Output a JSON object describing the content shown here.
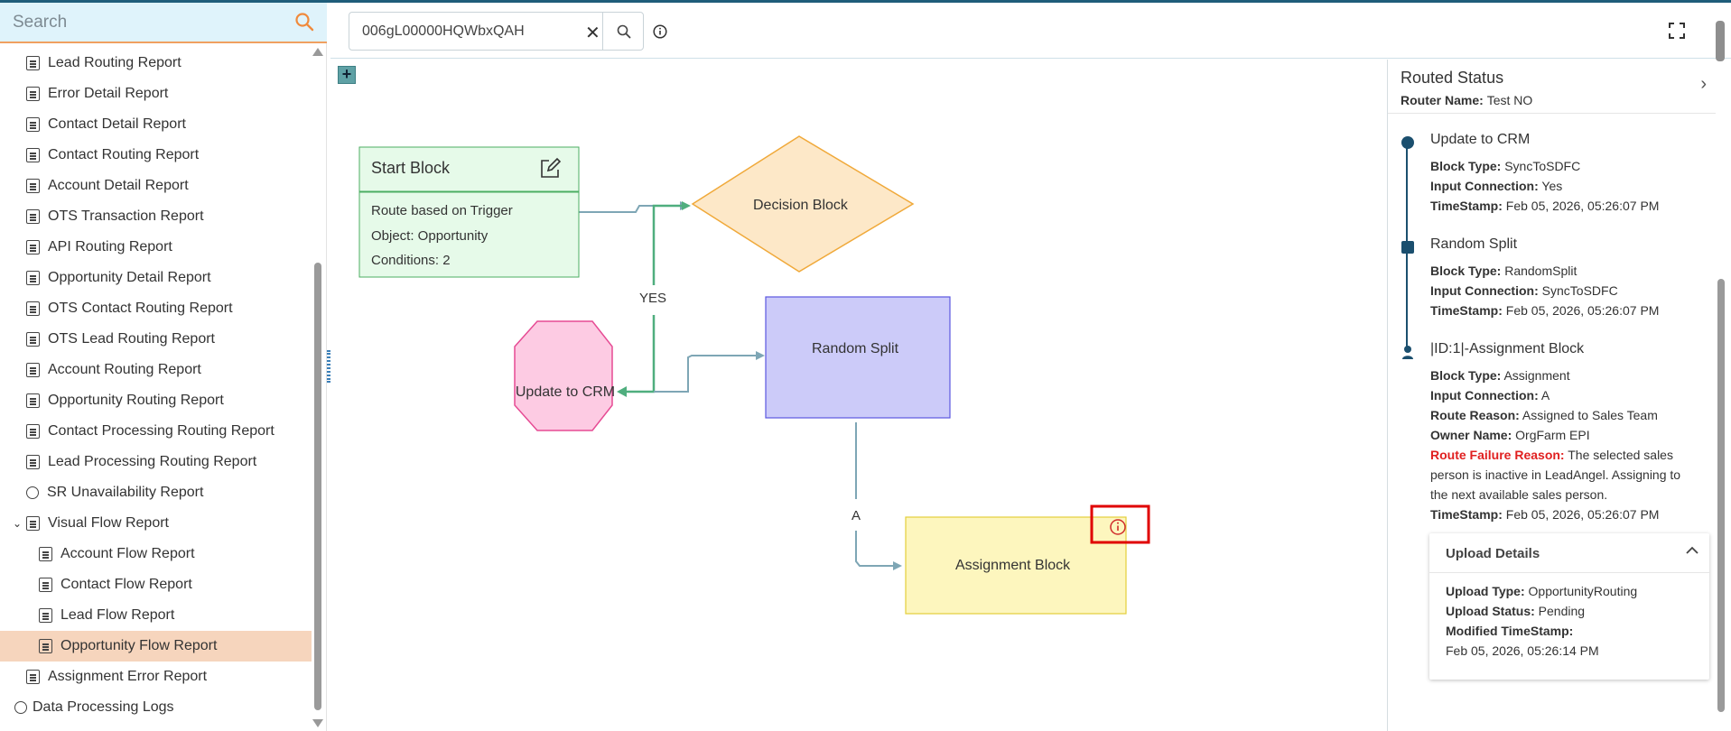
{
  "sidebar": {
    "search_placeholder": "Search",
    "items": [
      {
        "label": "Lead Routing Report",
        "level": 1
      },
      {
        "label": "Error Detail Report",
        "level": 1
      },
      {
        "label": "Contact Detail Report",
        "level": 1
      },
      {
        "label": "Contact Routing Report",
        "level": 1
      },
      {
        "label": "Account Detail Report",
        "level": 1
      },
      {
        "label": "OTS Transaction Report",
        "level": 1
      },
      {
        "label": "API Routing Report",
        "level": 1
      },
      {
        "label": "Opportunity Detail Report",
        "level": 1
      },
      {
        "label": "OTS Contact Routing Report",
        "level": 1
      },
      {
        "label": "OTS Lead Routing Report",
        "level": 1
      },
      {
        "label": "Account Routing Report",
        "level": 1
      },
      {
        "label": "Opportunity Routing Report",
        "level": 1
      },
      {
        "label": "Contact Processing Routing Report",
        "level": 1
      },
      {
        "label": "Lead Processing Routing Report",
        "level": 1
      },
      {
        "label": "SR Unavailability Report",
        "level": 1
      },
      {
        "label": "Visual Flow Report",
        "level": 1
      },
      {
        "label": "Account Flow Report",
        "level": 2
      },
      {
        "label": "Contact Flow Report",
        "level": 2
      },
      {
        "label": "Lead Flow Report",
        "level": 2
      },
      {
        "label": "Opportunity Flow Report",
        "level": 2
      },
      {
        "label": "Assignment Error Report",
        "level": 1
      },
      {
        "label": "Data Processing Logs",
        "level": 0
      }
    ]
  },
  "toolbar": {
    "query_value": "006gL00000HQWbxQAH"
  },
  "diagram": {
    "start_block": {
      "title": "Start Block",
      "line1": "Route based on Trigger",
      "line2": "Object: Opportunity",
      "line3": "Conditions: 2"
    },
    "decision_block": "Decision Block",
    "yes_label": "YES",
    "update_crm": "Update to CRM",
    "random_split": "Random Split",
    "a_label": "A",
    "assignment_block": "Assignment Block",
    "colors": {
      "start_fill": "#e6fae9",
      "start_border": "#4cae62",
      "decision_fill": "#fde8c8",
      "decision_border": "#f0a93a",
      "crm_fill": "#fdcbe3",
      "crm_border": "#e64b94",
      "split_fill": "#cccbf9",
      "split_border": "#5b57e0",
      "assign_fill": "#fdf6be",
      "assign_border": "#e3cf3b",
      "connector": "#7ea6b5",
      "yes_connector": "#4fae7e",
      "highlight": "#e00000"
    }
  },
  "panel": {
    "title": "Routed Status",
    "router_label": "Router Name:",
    "router_value": "Test NO",
    "entries": [
      {
        "title": "Update to CRM",
        "block_type_label": "Block Type:",
        "block_type": "SyncToSDFC",
        "input_label": "Input Connection:",
        "input": "Yes",
        "ts_label": "TimeStamp:",
        "ts": "Feb 05, 2026, 05:26:07 PM"
      },
      {
        "title": "Random Split",
        "block_type_label": "Block Type:",
        "block_type": "RandomSplit",
        "input_label": "Input Connection:",
        "input": "SyncToSDFC",
        "ts_label": "TimeStamp:",
        "ts": "Feb 05, 2026, 05:26:07 PM"
      },
      {
        "title": "|ID:1|-Assignment Block",
        "block_type_label": "Block Type:",
        "block_type": "Assignment",
        "input_label": "Input Connection:",
        "input": "A",
        "reason_label": "Route Reason:",
        "reason": "Assigned to Sales Team",
        "owner_label": "Owner Name:",
        "owner": "OrgFarm EPI",
        "failure_label": "Route Failure Reason:",
        "failure": "The selected sales person is inactive in LeadAngel. Assigning to the next available sales person.",
        "ts_label": "TimeStamp:",
        "ts": "Feb 05, 2026, 05:26:07 PM"
      }
    ],
    "upload": {
      "title": "Upload Details",
      "type_label": "Upload Type:",
      "type": "OpportunityRouting",
      "status_label": "Upload Status:",
      "status": "Pending",
      "modified_label": "Modified TimeStamp:",
      "modified": "Feb 05, 2026, 05:26:14 PM"
    }
  }
}
